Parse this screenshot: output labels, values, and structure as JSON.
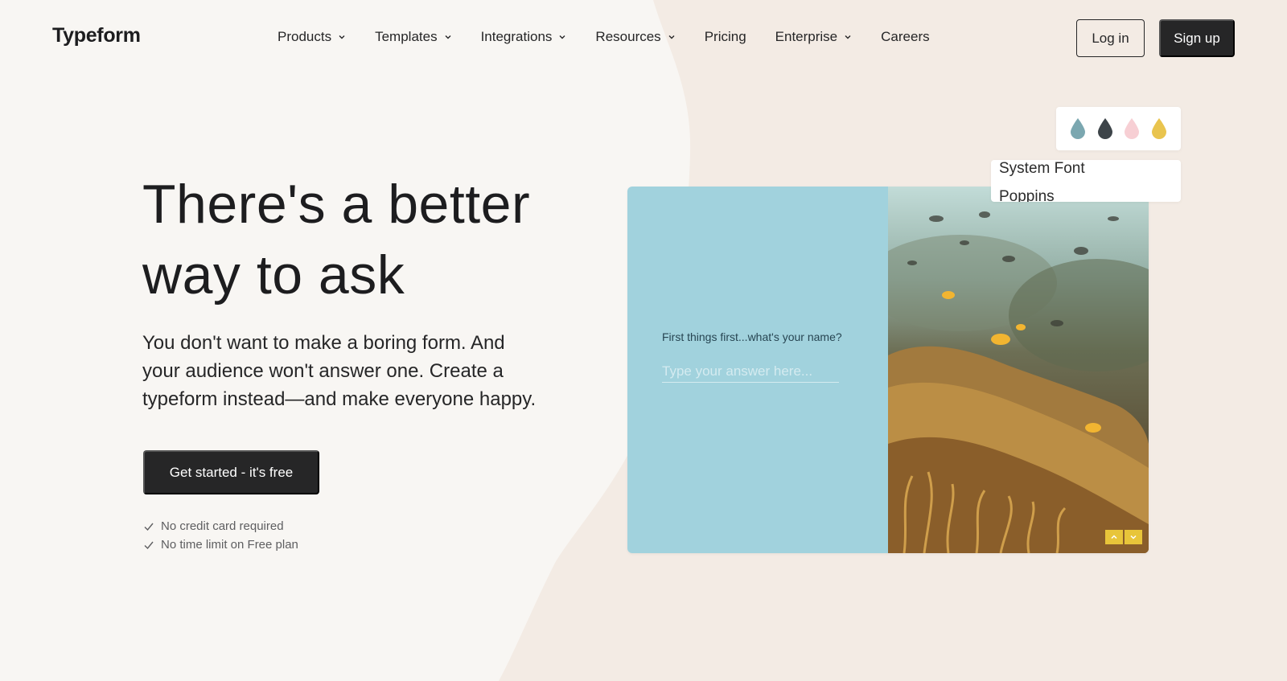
{
  "header": {
    "logo": "Typeform",
    "nav": [
      {
        "label": "Products",
        "dropdown": true
      },
      {
        "label": "Templates",
        "dropdown": true
      },
      {
        "label": "Integrations",
        "dropdown": true
      },
      {
        "label": "Resources",
        "dropdown": true
      },
      {
        "label": "Pricing",
        "dropdown": false
      },
      {
        "label": "Enterprise",
        "dropdown": true
      },
      {
        "label": "Careers",
        "dropdown": false
      }
    ],
    "login_label": "Log in",
    "signup_label": "Sign up"
  },
  "hero": {
    "title_line1": "There's a better",
    "title_line2": "way to ask",
    "subtitle_line1": "You don't want to make a boring form. And",
    "subtitle_line2": "your audience won't answer one. Create a",
    "subtitle_line3": "typeform instead—and make everyone happy.",
    "cta_label": "Get started - it's free",
    "checks": [
      "No credit card required",
      "No time limit on Free plan"
    ]
  },
  "preview": {
    "question": "First things first...what's your name?",
    "answer_placeholder": "Type your answer here...",
    "swatches": [
      "#7ba7b0",
      "#3d4449",
      "#f7cfd4",
      "#e9c44e"
    ],
    "fonts": [
      "System Font",
      "Poppins"
    ]
  },
  "colors": {
    "background": "#f8f6f3",
    "accent_shape": "#f3ebe4",
    "dark": "#262627",
    "preview_blue": "#a1d2dd",
    "arrow_yellow": "#e8c53a"
  }
}
